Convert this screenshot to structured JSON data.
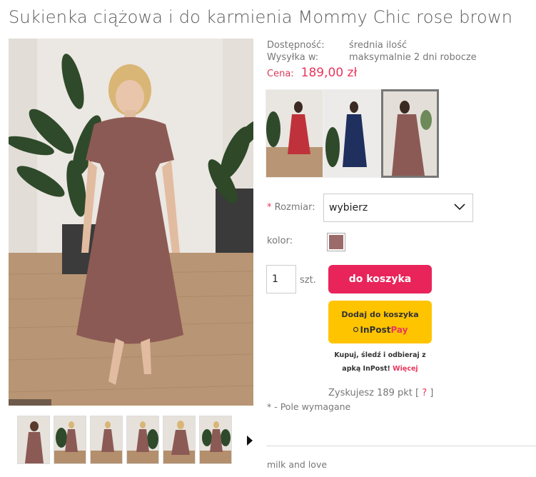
{
  "product": {
    "title": "Sukienka ciążowa i do karmienia Mommy Chic rose brown",
    "availability_label": "Dostępność:",
    "availability_value": "średnia ilość",
    "shipping_label": "Wysyłka w:",
    "shipping_value": "maksymalnie 2 dni robocze",
    "price_label": "Cena:",
    "price_value": "189,00 zł",
    "brand": "milk and love"
  },
  "variants": [
    {
      "color": "#c0323b"
    },
    {
      "color": "#1f2f5e"
    },
    {
      "color": "#8c5a55",
      "selected": true
    }
  ],
  "options": {
    "size_required_mark": "*",
    "size_label": "Rozmiar:",
    "size_value": "wybierz",
    "color_label": "kolor:",
    "color_value": "#9b6a6a"
  },
  "cart": {
    "qty_value": "1",
    "qty_unit": "szt.",
    "add_to_cart_label": "do koszyka",
    "add_to_cart_color": "#e8245a"
  },
  "inpost": {
    "button_text": "Dodaj do koszyka",
    "logo_in": "InPost",
    "logo_pay": "Pay",
    "button_color": "#ffc400",
    "note_line1": "Kupuj, śledź i odbieraj z",
    "note_line2": "apką InPost!",
    "note_link": "Więcej"
  },
  "loyalty": {
    "points_text": "Zyskujesz 189 pkt [",
    "help_mark": "?",
    "points_close": "]"
  },
  "required_note": "* - Pole wymagane",
  "colors": {
    "accent": "#e8365d",
    "dress": "#8c5a55"
  },
  "icons": {
    "select_chevron": "chevron-down-icon",
    "thumbs_next": "chevron-right-icon"
  }
}
